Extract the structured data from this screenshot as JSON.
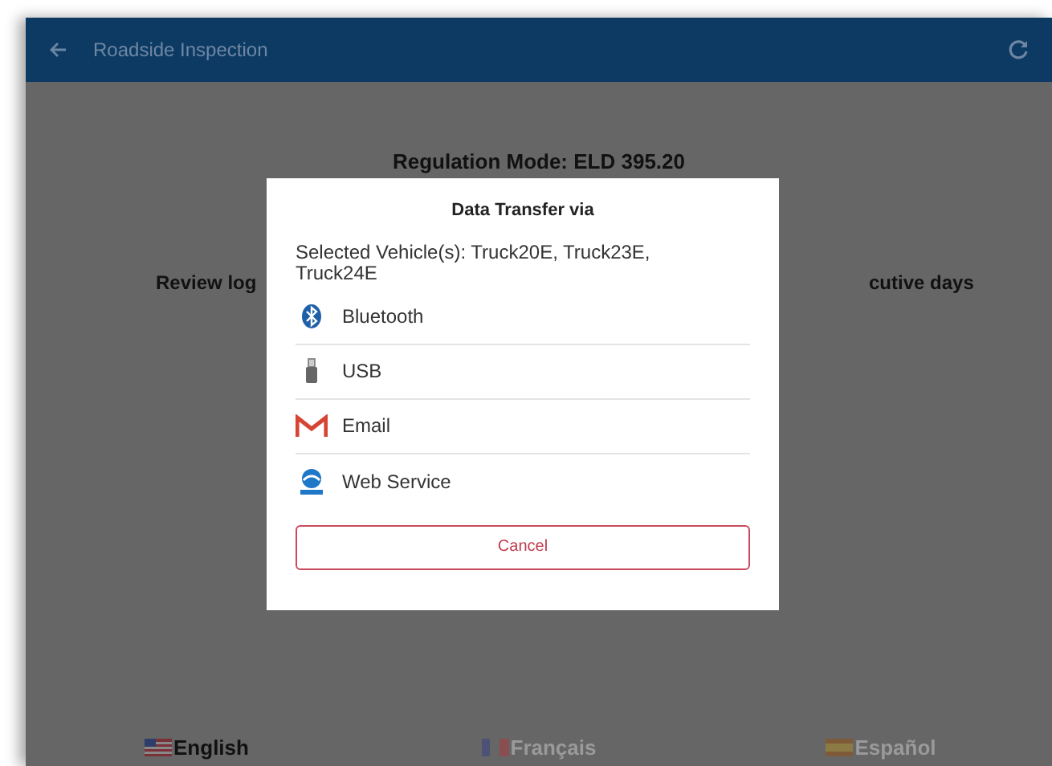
{
  "app_bar": {
    "title": "Roadside Inspection"
  },
  "regulation_mode": "Regulation Mode: ELD 395.20",
  "review_text_left": "Review log",
  "review_text_right": "cutive days",
  "dialog": {
    "title": "Data Transfer via",
    "vehicles": "Selected Vehicle(s): Truck20E, Truck23E, Truck24E",
    "options": [
      {
        "kind": "bluetooth",
        "label": "Bluetooth"
      },
      {
        "kind": "usb",
        "label": "USB"
      },
      {
        "kind": "email",
        "label": "Email"
      },
      {
        "kind": "web",
        "label": "Web Service"
      }
    ],
    "cancel": "Cancel"
  },
  "languages": [
    {
      "kind": "us",
      "label": "English",
      "selected": true
    },
    {
      "kind": "fr",
      "label": "Français",
      "selected": false
    },
    {
      "kind": "es",
      "label": "Español",
      "selected": false
    }
  ]
}
